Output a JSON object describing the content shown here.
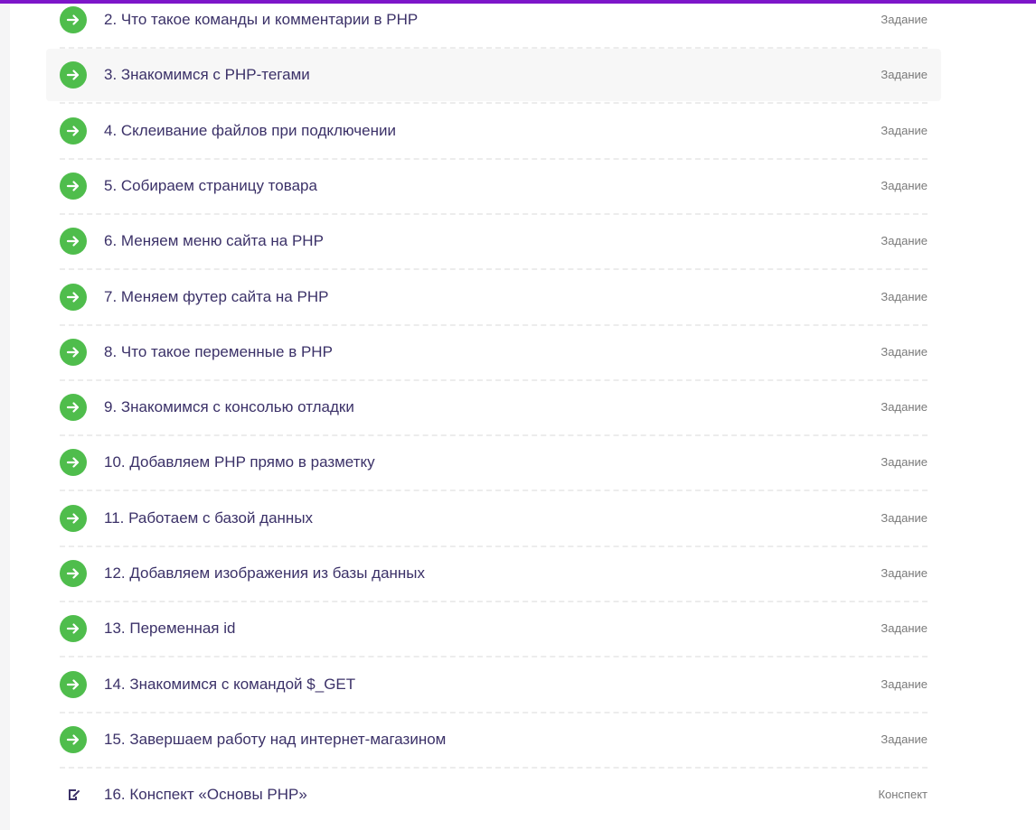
{
  "colors": {
    "accent_bar": "#7d16c9",
    "done_icon": "#4fbd4c",
    "title_text": "#3b3168",
    "type_text": "#7a7a7a",
    "hover_row": "#f7f7f7"
  },
  "lessons": [
    {
      "title": "2. Что такое команды и комментарии в PHP",
      "type": "Задание",
      "icon": "arrow-right-icon",
      "completed": true
    },
    {
      "title": "3. Знакомимся с PHP-тегами",
      "type": "Задание",
      "icon": "arrow-right-icon",
      "completed": true,
      "hovered": true
    },
    {
      "title": "4. Склеивание файлов при подключении",
      "type": "Задание",
      "icon": "arrow-right-icon",
      "completed": true
    },
    {
      "title": "5. Собираем страницу товара",
      "type": "Задание",
      "icon": "arrow-right-icon",
      "completed": true
    },
    {
      "title": "6. Меняем меню сайта на PHP",
      "type": "Задание",
      "icon": "arrow-right-icon",
      "completed": true
    },
    {
      "title": "7. Меняем футер сайта на PHP",
      "type": "Задание",
      "icon": "arrow-right-icon",
      "completed": true
    },
    {
      "title": "8. Что такое переменные в PHP",
      "type": "Задание",
      "icon": "arrow-right-icon",
      "completed": true
    },
    {
      "title": "9. Знакомимся с консолью отладки",
      "type": "Задание",
      "icon": "arrow-right-icon",
      "completed": true
    },
    {
      "title": "10. Добавляем PHP прямо в разметку",
      "type": "Задание",
      "icon": "arrow-right-icon",
      "completed": true
    },
    {
      "title": "11. Работаем с базой данных",
      "type": "Задание",
      "icon": "arrow-right-icon",
      "completed": true
    },
    {
      "title": "12. Добавляем изображения из базы данных",
      "type": "Задание",
      "icon": "arrow-right-icon",
      "completed": true
    },
    {
      "title": "13. Переменная id",
      "type": "Задание",
      "icon": "arrow-right-icon",
      "completed": true
    },
    {
      "title": "14. Знакомимся с командой $_GET",
      "type": "Задание",
      "icon": "arrow-right-icon",
      "completed": true
    },
    {
      "title": "15. Завершаем работу над интернет-магазином",
      "type": "Задание",
      "icon": "arrow-right-icon",
      "completed": true
    },
    {
      "title": "16. Конспект «Основы PHP»",
      "type": "Конспект",
      "icon": "notes-icon",
      "completed": false
    }
  ]
}
